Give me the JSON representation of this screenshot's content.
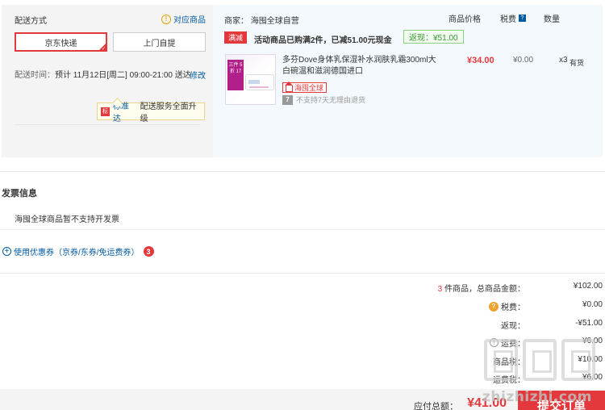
{
  "delivery": {
    "title": "配送方式",
    "link_label": "对应商品",
    "options": [
      "京东快递",
      "上门自提"
    ],
    "selected": "京东快递",
    "time_label": "配送时间：",
    "time_value": "预计 11月12日[周二] 09:00-21:00 送达",
    "edit_label": "修改",
    "standard_name": "标准达",
    "standard_desc": "配送服务全面升级",
    "standard_icon": "标"
  },
  "shop": {
    "merchant": "商家：  海囤全球自营",
    "col_price": "商品价格",
    "col_tax": "税费",
    "col_qty": "数量",
    "promo_badge": "满减",
    "promo_text": "活动商品已购满2件，已减51.00元现金",
    "rebate": "返现：¥51.00",
    "product": {
      "image_tag": "三件 5折 17",
      "name": "多芬Dove身体乳保湿补水润肤乳霜300ml大白碗温和滋润德国进口",
      "price": "¥34.00",
      "tax": "¥0.00",
      "qty": "x3",
      "stock": "有货",
      "global_tag": "海囤全球",
      "return_icon": "7",
      "return_policy": "不支持7天无理由退货"
    }
  },
  "invoice": {
    "title": "发票信息",
    "text": "海囤全球商品暂不支持开发票"
  },
  "coupon": {
    "label": "使用优惠券（京券/东券/免运费券）",
    "count": "3"
  },
  "summary": {
    "count": "3",
    "count_suffix": " 件商品，总商品金额：",
    "amount": "¥102.00",
    "tax_label": "税费：",
    "tax": "¥0.00",
    "rebate_label": "返现：",
    "rebate": "-¥51.00",
    "shipping_label": "运费：",
    "shipping": "¥6.00",
    "row5_label": "商品税：",
    "row5_val": "¥10.00",
    "row6_label": "运费税：",
    "row6_val": "¥6.00",
    "total_label": "应付总额：",
    "total": "¥41.00",
    "submit": "提交订单"
  },
  "watermark": "zhizhizhi.com",
  "colors": {
    "accent_red": "#e4393c",
    "link_blue": "#005aa0",
    "rebate_green": "#3c9a34"
  }
}
